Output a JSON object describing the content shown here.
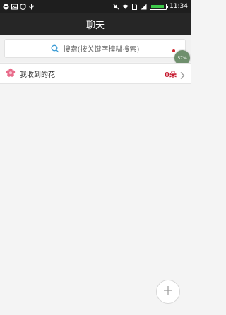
{
  "status_bar": {
    "time": "11:34"
  },
  "header": {
    "title": "聊天"
  },
  "search": {
    "placeholder": "搜索(按关键字模糊搜索)"
  },
  "flowers_row": {
    "label": "我收到的花",
    "count": "0朵"
  },
  "progress_badge": {
    "text": "57%"
  },
  "colors": {
    "header_bg": "#262626",
    "accent_red": "#c5162c",
    "flower_pink": "#e96b8a"
  },
  "icons": {
    "search": "search-icon",
    "flower": "flower-icon",
    "chevron": "chevron-right-icon",
    "add": "plus-icon"
  }
}
